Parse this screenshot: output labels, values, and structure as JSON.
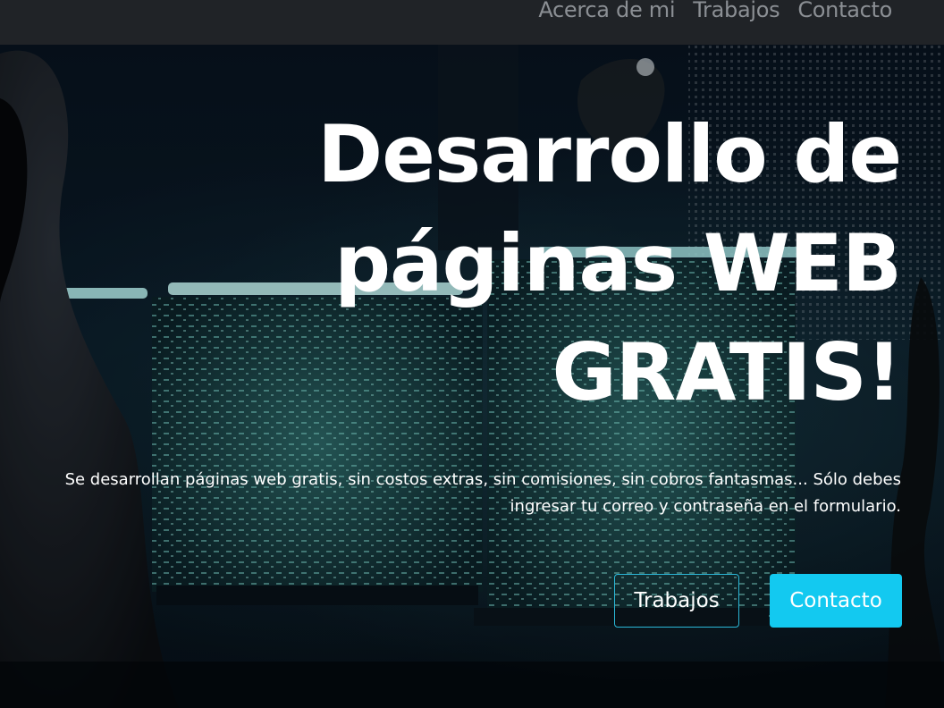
{
  "navbar": {
    "links": [
      {
        "label": "Acerca de mi"
      },
      {
        "label": "Trabajos"
      },
      {
        "label": "Contacto"
      }
    ]
  },
  "hero": {
    "title": "Desarrollo de páginas WEB GRATIS!",
    "description": "Se desarrollan páginas web gratis, sin costos extras, sin comisiones, sin cobros fantasmas... Sólo debes ingresar tu correo y contraseña en el formulario.",
    "buttons": {
      "secondary_label": "Trabajos",
      "primary_label": "Contacto"
    },
    "background_icon": "hacker-at-monitors-image"
  },
  "colors": {
    "navbar_bg": "#202327",
    "nav_link": "#8b8f94",
    "accent": "#13c9f0",
    "outline_border": "#2ab6d6",
    "text": "#ffffff"
  }
}
